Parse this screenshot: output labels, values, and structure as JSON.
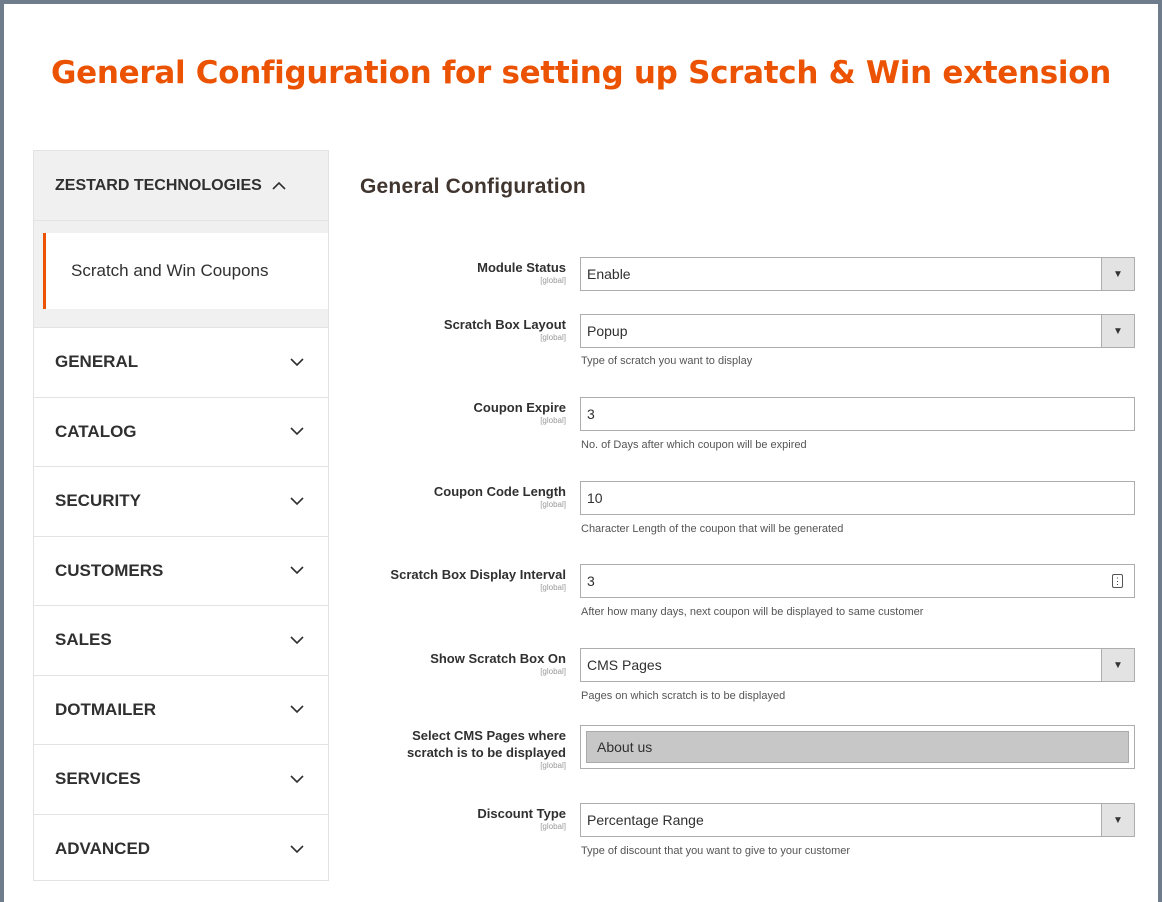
{
  "banner_title": "General Configuration for setting up Scratch & Win extension",
  "sidebar": {
    "section_title": "ZESTARD TECHNOLOGIES",
    "sub_item": "Scratch and Win Coupons",
    "items": [
      "GENERAL",
      "CATALOG",
      "SECURITY",
      "CUSTOMERS",
      "SALES",
      "DOTMAILER",
      "SERVICES",
      "ADVANCED"
    ]
  },
  "main": {
    "title": "General Configuration",
    "scope_label": "[global]",
    "fields": {
      "module_status": {
        "label": "Module Status",
        "value": "Enable"
      },
      "scratch_box_layout": {
        "label": "Scratch Box Layout",
        "value": "Popup",
        "note": "Type of scratch you want to display"
      },
      "coupon_expire": {
        "label": "Coupon Expire",
        "value": "3",
        "note": "No. of Days after which coupon will be expired"
      },
      "coupon_code_length": {
        "label": "Coupon Code Length",
        "value": "10",
        "note": "Character Length of the coupon that will be generated"
      },
      "display_interval": {
        "label": "Scratch Box Display Interval",
        "value": "3",
        "note": "After how many days, next coupon will be displayed to same customer"
      },
      "show_on": {
        "label": "Show Scratch Box On",
        "value": "CMS Pages",
        "note": "Pages on which scratch is to be displayed"
      },
      "cms_pages": {
        "label_line1": "Select CMS Pages where",
        "label_line2": "scratch is to be displayed",
        "selected": "About us"
      },
      "discount_type": {
        "label": "Discount Type",
        "value": "Percentage Range",
        "note": "Type of discount that you want to give to your customer"
      }
    }
  },
  "colors": {
    "accent": "#eb5202",
    "sidebar_bg": "#f0f0f0",
    "frame": "#6f7c8c"
  }
}
